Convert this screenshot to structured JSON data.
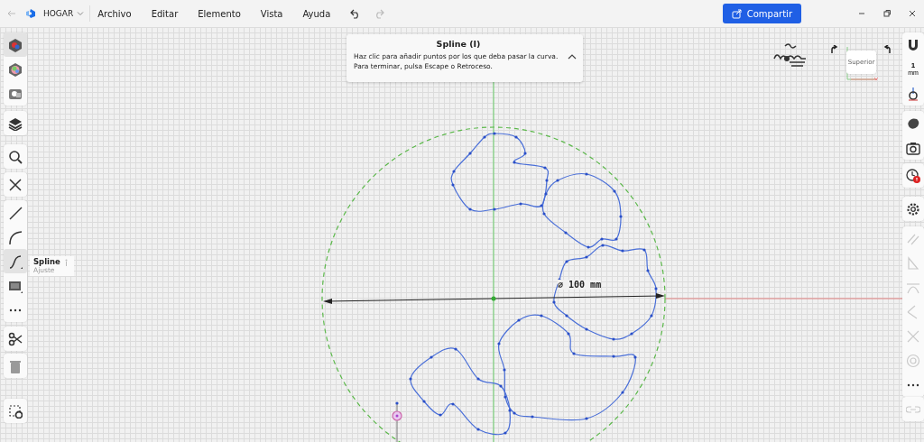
{
  "title_bar": {
    "project": "HOGAR",
    "menu": [
      "Archivo",
      "Editar",
      "Elemento",
      "Vista",
      "Ayuda"
    ],
    "share_button": "Compartir"
  },
  "hint": {
    "title": "Spline (I)",
    "lines": [
      "Haz clic para añadir puntos por los que deba pasar la curva.",
      "Para terminar, pulsa Escape o Retroceso."
    ]
  },
  "left_toolbar": {
    "groups": [
      {
        "tools": [
          {
            "kind": "appearance",
            "selected": true
          },
          {
            "kind": "color",
            "selected": false
          },
          {
            "kind": "render",
            "selected": false
          }
        ]
      },
      {
        "tools": [
          {
            "kind": "layers",
            "selected": false
          }
        ]
      },
      {
        "tools": [
          {
            "kind": "search",
            "selected": false
          }
        ]
      },
      {
        "tools": [
          {
            "kind": "close",
            "selected": false
          }
        ]
      },
      {
        "tools": [
          {
            "kind": "line",
            "selected": false
          },
          {
            "kind": "arc",
            "selected": false
          },
          {
            "kind": "spline",
            "selected": true
          },
          {
            "kind": "rectangle",
            "selected": false
          },
          {
            "kind": "more",
            "selected": false
          }
        ]
      },
      {
        "tools": [
          {
            "kind": "scissors",
            "selected": false
          }
        ]
      },
      {
        "tools": [
          {
            "kind": "trash",
            "selected": false
          }
        ]
      },
      {
        "tools": [
          {
            "kind": "select",
            "selected": false
          }
        ]
      }
    ]
  },
  "tool_tooltip": {
    "title": "Spline",
    "subtitle": "Ajuste"
  },
  "view_cube": {
    "face": "Superior"
  },
  "right_toolbar": {
    "groups": [
      {
        "tools": [
          {
            "kind": "magnet",
            "disabled": false
          },
          {
            "kind": "scale",
            "value": "1",
            "unit": "mm",
            "disabled": false
          },
          {
            "kind": "axes",
            "disabled": false
          }
        ]
      },
      {
        "tools": [
          {
            "kind": "material",
            "disabled": false
          },
          {
            "kind": "camera",
            "disabled": false
          }
        ]
      },
      {
        "tools": [
          {
            "kind": "history",
            "disabled": false
          }
        ]
      },
      {
        "tools": [
          {
            "kind": "settings",
            "disabled": false
          }
        ]
      },
      {
        "tools": [
          {
            "kind": "parallel",
            "disabled": true
          },
          {
            "kind": "angle",
            "disabled": true
          },
          {
            "kind": "tangent",
            "disabled": true
          },
          {
            "kind": "perpendicular",
            "disabled": true
          },
          {
            "kind": "cross",
            "disabled": true
          },
          {
            "kind": "concentric",
            "disabled": true
          },
          {
            "kind": "more",
            "disabled": false
          }
        ]
      },
      {
        "tools": [
          {
            "kind": "link",
            "disabled": true
          }
        ]
      }
    ]
  },
  "dimension": {
    "label": "⌀ 100 mm"
  }
}
